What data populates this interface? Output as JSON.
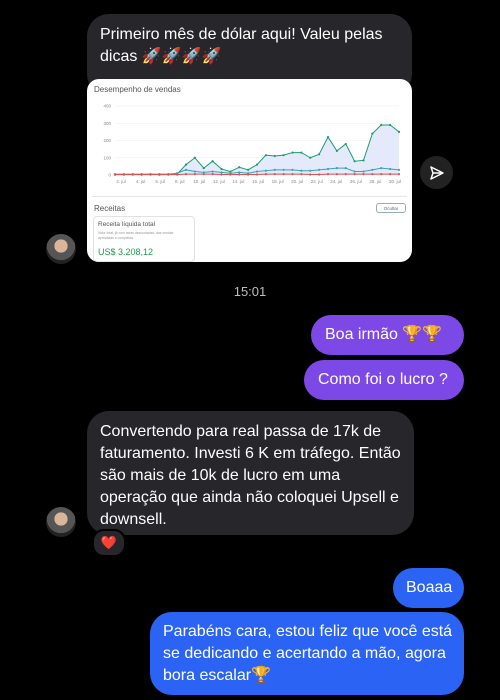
{
  "messages": {
    "m1": "Primeiro mês de dólar aqui! Valeu pelas dicas 🚀🚀🚀🚀",
    "timestamp": "15:01",
    "m2": "Boa irmão 🏆🏆",
    "m3": "Como foi o lucro ?",
    "m4": "Convertendo para real passa de 17k de faturamento. Investi 6 K em tráfego. Então são mais de 10k de lucro em uma operação que ainda não coloquei Upsell e downsell.",
    "m5": "Boaaa",
    "m6": "Parabéns cara, estou feliz que você está se dedicando e acertando a mão, agora bora escalar🏆",
    "reaction": "❤️"
  },
  "card": {
    "title": "Desempenho de vendas",
    "section": "Receitas",
    "button_label": "Ocultar",
    "box_title": "Receita líquida total",
    "box_desc": "Valor total, já com taxas descontadas, das vendas aprovadas e completas.",
    "box_value": "US$ 3.208,12"
  },
  "chart_data": {
    "type": "line",
    "ylim": [
      0,
      400
    ],
    "y_ticks": [
      "400",
      "300",
      "200",
      "100",
      "0"
    ],
    "x_ticks": [
      "2. jul",
      "4. jul",
      "6. jul",
      "8. jul",
      "10. jul",
      "12. jul",
      "14. jul",
      "16. jul",
      "18. jul",
      "20. jul",
      "22. jul",
      "24. jul",
      "26. jul",
      "28. jul",
      "30. jul"
    ],
    "x": [
      1,
      2,
      3,
      4,
      5,
      6,
      7,
      8,
      9,
      10,
      11,
      12,
      13,
      14,
      15,
      16,
      17,
      18,
      19,
      20,
      21,
      22,
      23,
      24,
      25,
      26,
      27,
      28,
      29,
      30,
      31
    ],
    "series": [
      {
        "values": [
          2,
          3,
          3,
          2,
          4,
          2,
          3,
          5,
          60,
          100,
          40,
          80,
          35,
          20,
          45,
          30,
          60,
          115,
          110,
          115,
          130,
          130,
          100,
          120,
          220,
          140,
          180,
          80,
          85,
          240,
          290,
          290,
          250
        ],
        "color": "#1c9c6c"
      },
      {
        "values": [
          5,
          5,
          5,
          5,
          5,
          5,
          5,
          10,
          30,
          20,
          15,
          20,
          15,
          10,
          15,
          10,
          20,
          25,
          30,
          30,
          30,
          25,
          25,
          30,
          35,
          40,
          40,
          20,
          20,
          30,
          40,
          35,
          30
        ],
        "color": "#3aa0b5"
      },
      {
        "values": [
          2,
          2,
          2,
          2,
          2,
          2,
          2,
          2,
          5,
          5,
          5,
          5,
          3,
          3,
          3,
          3,
          3,
          5,
          5,
          5,
          5,
          5,
          3,
          3,
          5,
          5,
          5,
          5,
          5,
          5,
          5,
          5,
          5
        ],
        "color": "#e05050"
      }
    ]
  }
}
